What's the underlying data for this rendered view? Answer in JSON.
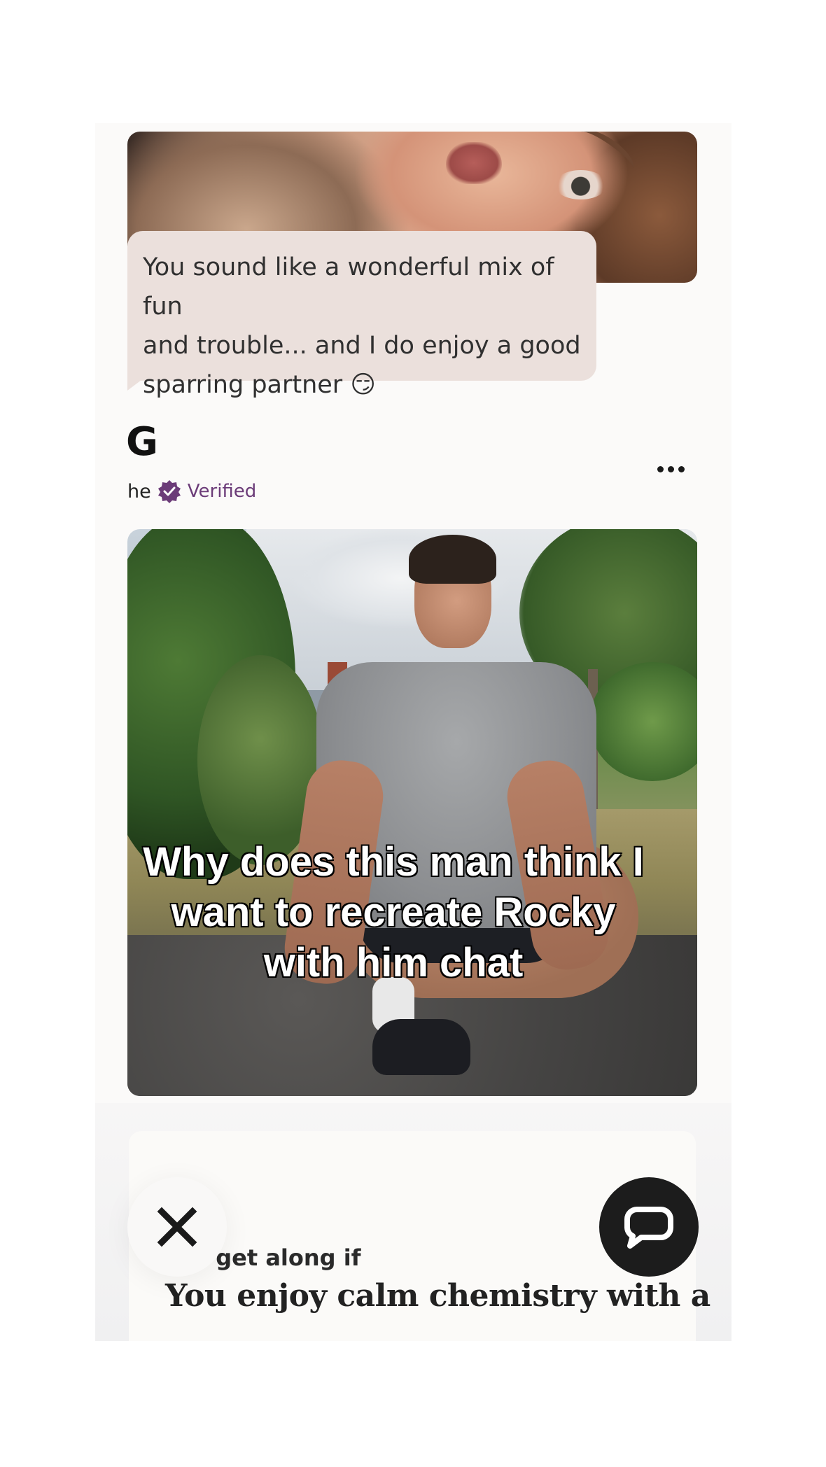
{
  "message": {
    "text": "You sound like a wonderful mix of fun and trouble... and I do enjoy a good sparring partner 😏",
    "line1": "You sound like a wonderful mix of fun",
    "line2": "and trouble... and I do enjoy a good",
    "line3": "sparring partner 😏"
  },
  "profile": {
    "name": "G",
    "pronoun": "he",
    "verified_label": "Verified",
    "verified_color": "#6b3b78",
    "more_icon": "more-horizontal-icon"
  },
  "photo": {
    "caption_line1": "Why does this man think I",
    "caption_line2": "want to recreate Rocky",
    "caption_line3": "with him chat"
  },
  "prompt": {
    "label": "’ı get along if",
    "answer": "You enjoy calm chemistry with a"
  },
  "actions": {
    "skip_icon": "close-icon",
    "chat_icon": "chat-bubble-icon"
  }
}
